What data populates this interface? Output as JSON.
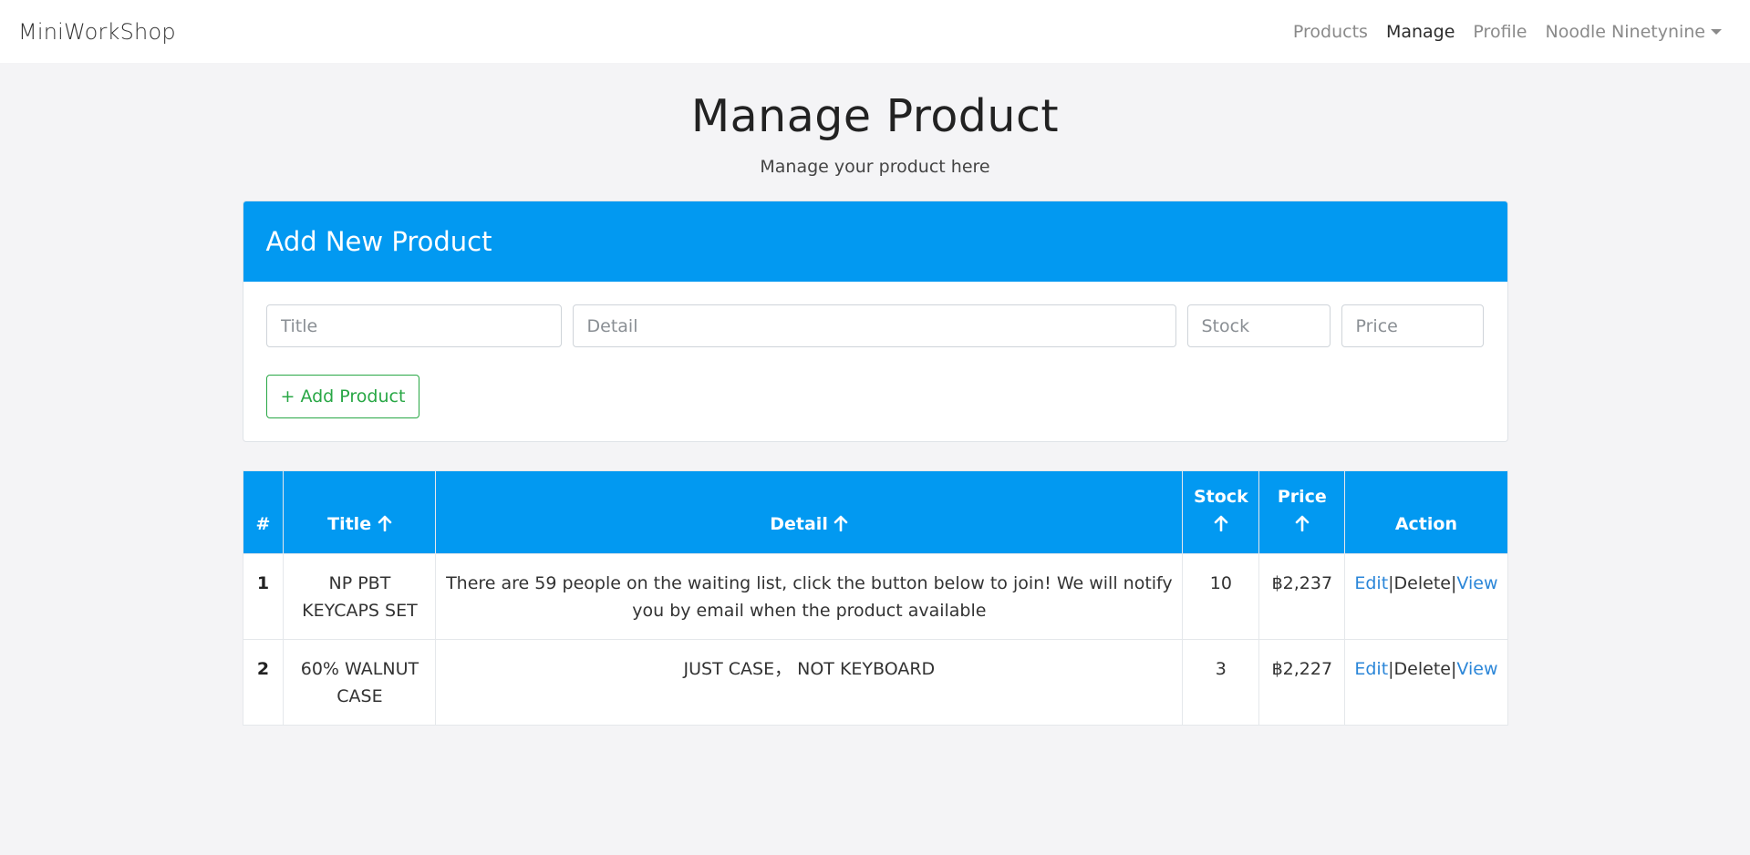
{
  "navbar": {
    "brand": "MiniWorkShop",
    "links": [
      "Products",
      "Manage",
      "Profile",
      "Noodle Ninetynine"
    ]
  },
  "header": {
    "title": "Manage Product",
    "subtitle": "Manage your product here"
  },
  "add_card": {
    "title": "Add New Product",
    "placeholders": {
      "title": "Title",
      "detail": "Detail",
      "stock": "Stock",
      "price": "Price"
    },
    "button": "+ Add Product"
  },
  "table": {
    "headers": {
      "index": "#",
      "title": "Title",
      "detail": "Detail",
      "stock": "Stock",
      "price": "Price",
      "action": "Action"
    },
    "rows": [
      {
        "index": "1",
        "title": "NP PBT KEYCAPS SET",
        "detail": "There are 59 people on the waiting list, click the button below to join! We will notify you by email when the product available",
        "stock": "10",
        "price": "฿2,237",
        "actions": [
          "Edit",
          "Delete",
          "View"
        ]
      },
      {
        "index": "2",
        "title": "60% WALNUT CASE",
        "detail": "JUST CASE， NOT KEYBOARD",
        "stock": "3",
        "price": "฿2,227",
        "actions": [
          "Edit",
          "Delete",
          "View"
        ]
      }
    ],
    "separator": "|"
  },
  "colors": {
    "primary": "#0299f1",
    "success": "#28a745",
    "link": "#2b86d8",
    "background": "#f4f4f6"
  },
  "icons": {
    "sort": "arrow-up-icon",
    "dropdown": "caret-down-icon"
  }
}
